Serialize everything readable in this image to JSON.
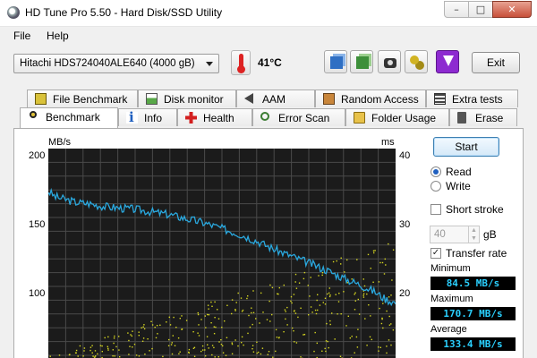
{
  "window": {
    "title": "HD Tune Pro 5.50 - Hard Disk/SSD Utility",
    "controls": {
      "minimize": "–",
      "maximize": "□",
      "close": "✕"
    }
  },
  "menu": {
    "items": [
      "File",
      "Help"
    ]
  },
  "toolbar": {
    "drive": "Hitachi HDS724040ALE640 (4000 gB)",
    "temperature": "41°C",
    "exit_label": "Exit",
    "icons": [
      "copy-icon",
      "save-icon",
      "camera-icon",
      "chain-icon",
      "download-icon"
    ]
  },
  "tabs": {
    "row1": [
      "File Benchmark",
      "Disk monitor",
      "AAM",
      "Random Access",
      "Extra tests"
    ],
    "row2": [
      "Benchmark",
      "Info",
      "Health",
      "Error Scan",
      "Folder Usage",
      "Erase"
    ],
    "active": "Benchmark"
  },
  "controls": {
    "start_label": "Start",
    "read_label": "Read",
    "write_label": "Write",
    "mode_selected": "Read",
    "short_stroke_label": "Short stroke",
    "short_stroke_checked": false,
    "stroke_value": "40",
    "stroke_unit": "gB",
    "transfer_rate_label": "Transfer rate",
    "transfer_rate_checked": true
  },
  "stats": {
    "minimum_label": "Minimum",
    "minimum_value": "84.5 MB/s",
    "maximum_label": "Maximum",
    "maximum_value": "170.7 MB/s",
    "average_label": "Average",
    "average_value": "133.4 MB/s"
  },
  "colors": {
    "plot_bg": "#1b1b1b",
    "grid": "#4a4a4a",
    "transfer_line": "#2aa8de",
    "access_dots": "#d8d820",
    "stat_text": "#2ad0ff"
  },
  "chart_data": {
    "type": "line",
    "title": "",
    "ylabel_left": "MB/s",
    "ylabel_right": "ms",
    "left_ticks": [
      "200",
      "150",
      "100"
    ],
    "right_ticks": [
      "40",
      "30",
      "20"
    ],
    "ylim_left": [
      50,
      200
    ],
    "ylim_right": [
      10,
      40
    ],
    "grid": true,
    "x_visible_fraction": [
      0,
      1
    ],
    "series": [
      {
        "axis": "left",
        "x": [
          0,
          0.02,
          0.05,
          0.08,
          0.12,
          0.16,
          0.2,
          0.25,
          0.3,
          0.35,
          0.4,
          0.45,
          0.5,
          0.55,
          0.6,
          0.65,
          0.7,
          0.75,
          0.8,
          0.85,
          0.9,
          0.94,
          0.97,
          1.0
        ],
        "values": [
          169,
          165,
          163,
          161,
          160,
          158,
          157,
          156,
          154,
          152,
          149,
          146,
          142,
          138,
          133,
          127,
          122,
          117,
          112,
          106,
          101,
          96,
          91,
          88
        ]
      }
    ],
    "access_time_scatter": {
      "axis": "right",
      "approx_min_ms": 4,
      "approx_max_ms": 27
    }
  }
}
